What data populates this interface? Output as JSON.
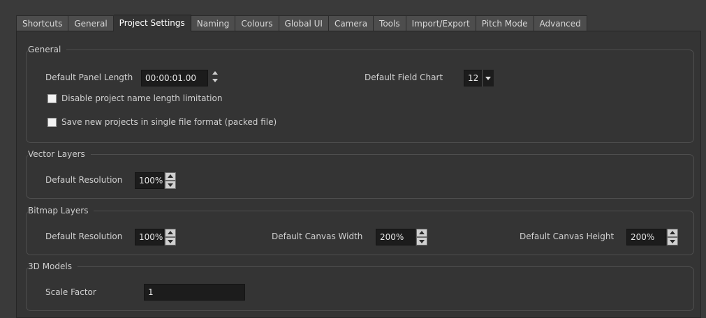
{
  "tabs": [
    {
      "label": "Shortcuts",
      "active": false
    },
    {
      "label": "General",
      "active": false
    },
    {
      "label": "Project Settings",
      "active": true
    },
    {
      "label": "Naming",
      "active": false
    },
    {
      "label": "Colours",
      "active": false
    },
    {
      "label": "Global UI",
      "active": false
    },
    {
      "label": "Camera",
      "active": false
    },
    {
      "label": "Tools",
      "active": false
    },
    {
      "label": "Import/Export",
      "active": false
    },
    {
      "label": "Pitch Mode",
      "active": false
    },
    {
      "label": "Advanced",
      "active": false
    }
  ],
  "general": {
    "title": "General",
    "panel_length_label": "Default Panel Length",
    "panel_length_value": "00:00:01.00",
    "field_chart_label": "Default Field Chart",
    "field_chart_value": "12",
    "disable_name_limit_label": "Disable project name length limitation",
    "disable_name_limit_checked": false,
    "single_file_label": "Save new projects in single file format (packed file)",
    "single_file_checked": false
  },
  "vector": {
    "title": "Vector Layers",
    "resolution_label": "Default Resolution",
    "resolution_value": "100%"
  },
  "bitmap": {
    "title": "Bitmap Layers",
    "resolution_label": "Default Resolution",
    "resolution_value": "100%",
    "canvas_width_label": "Default Canvas Width",
    "canvas_width_value": "200%",
    "canvas_height_label": "Default Canvas Height",
    "canvas_height_value": "200%"
  },
  "models3d": {
    "title": "3D Models",
    "scale_label": "Scale Factor",
    "scale_value": "1"
  }
}
